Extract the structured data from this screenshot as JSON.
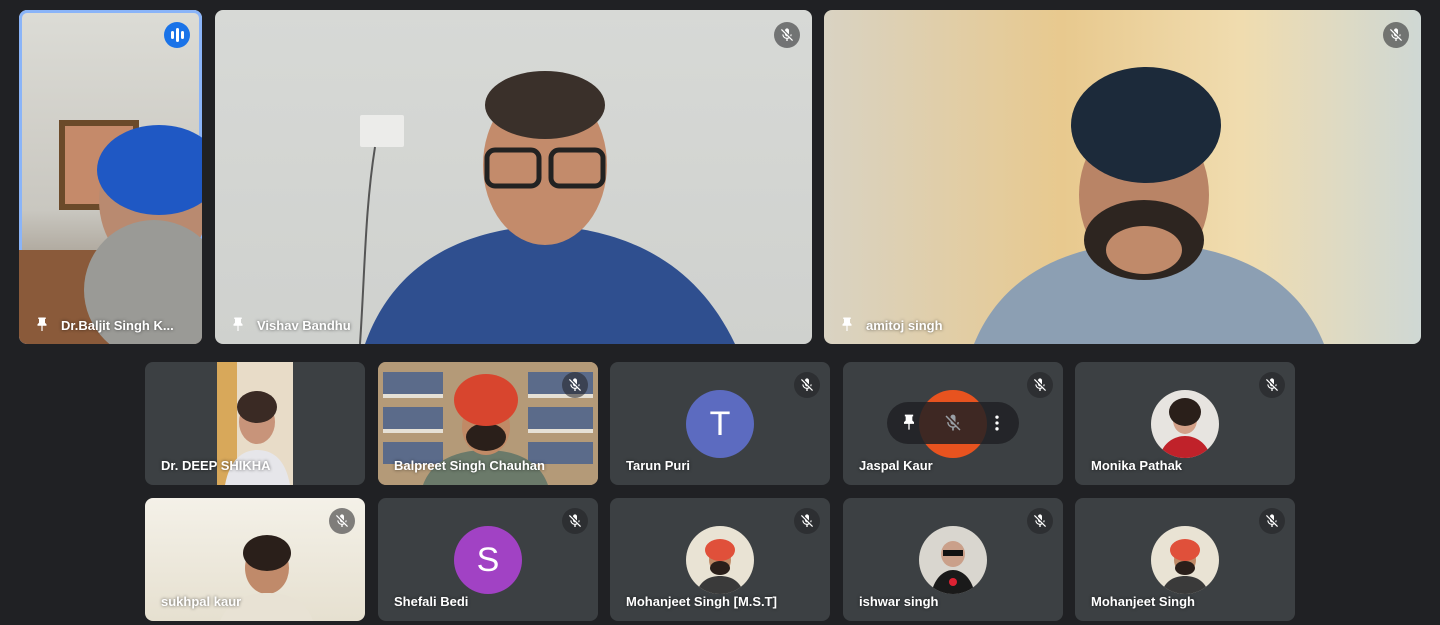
{
  "participants": {
    "baljit": {
      "name": "Dr.Baljit Singh K..."
    },
    "vishav": {
      "name": "Vishav Bandhu"
    },
    "amitoj": {
      "name": "amitoj singh"
    },
    "deep": {
      "name": "Dr. DEEP SHIKHA"
    },
    "balpreet": {
      "name": "Balpreet Singh Chauhan"
    },
    "tarun": {
      "name": "Tarun Puri",
      "initial": "T",
      "avatar_color": "#5c6bc0"
    },
    "jaspal": {
      "name": "Jaspal Kaur"
    },
    "monika": {
      "name": "Monika Pathak"
    },
    "sukhpal": {
      "name": "sukhpal kaur"
    },
    "shefali": {
      "name": "Shefali Bedi",
      "initial": "S",
      "avatar_color": "#a142c4"
    },
    "mohanjeet_mst": {
      "name": "Mohanjeet Singh [M.S.T]"
    },
    "ishwar": {
      "name": "ishwar singh"
    },
    "mohanjeet": {
      "name": "Mohanjeet Singh"
    }
  },
  "icons": {
    "mic_off": "mic-off-icon",
    "pin": "pin-icon",
    "more": "more-vert-icon",
    "speaking": "audio-level-icon"
  }
}
